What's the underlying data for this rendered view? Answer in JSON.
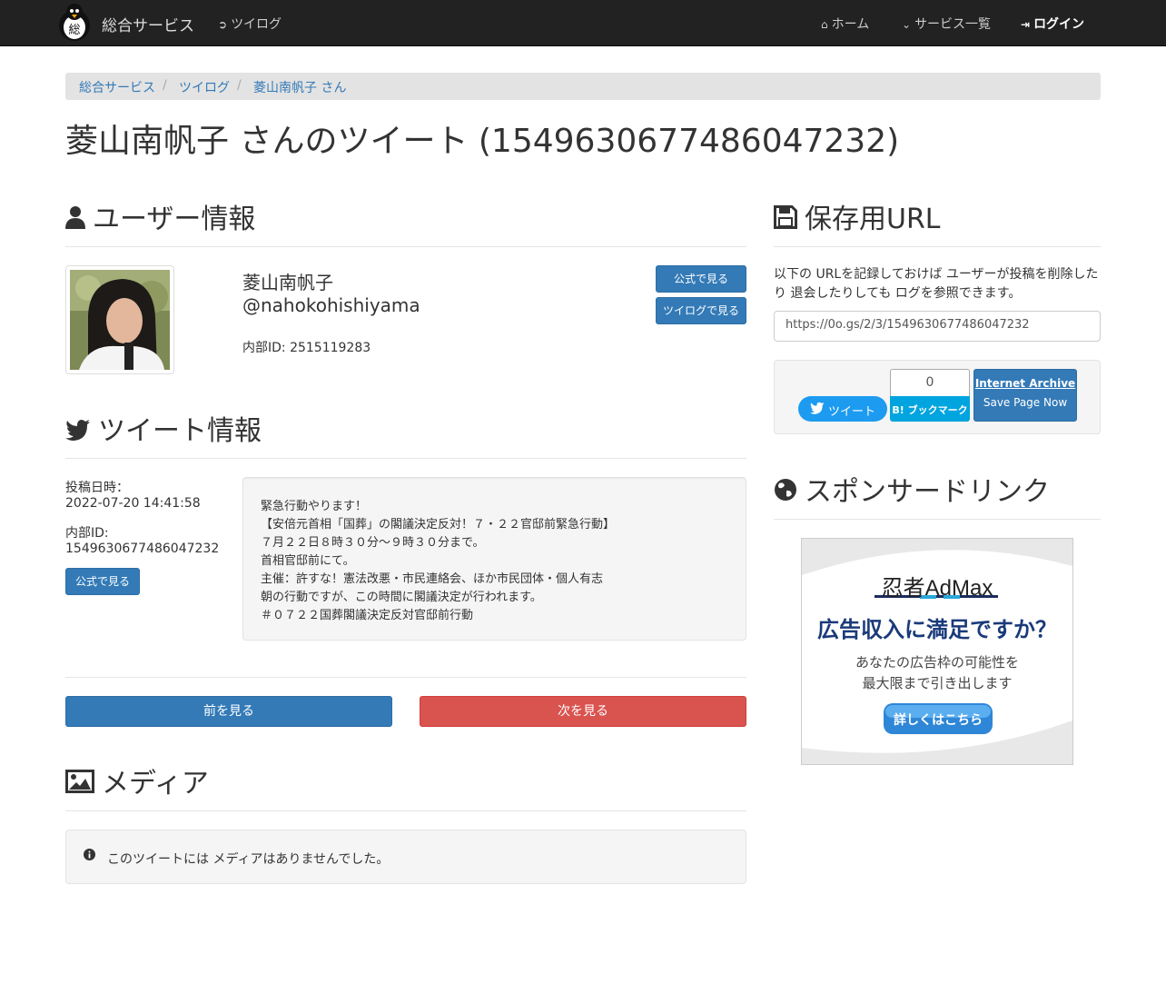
{
  "nav": {
    "brand": "総合サービス",
    "logo_char": "総",
    "left_link": "ツイログ",
    "home": "ホーム",
    "services": "サービス一覧",
    "login": "ログイン"
  },
  "breadcrumb": [
    "総合サービス",
    "ツイログ",
    "菱山南帆子 さん"
  ],
  "page_title": "菱山南帆子 さんのツイート (1549630677486047232)",
  "user_section": {
    "heading": "ユーザー情報",
    "name": "菱山南帆子",
    "handle": "@nahokohishiyama",
    "internal_id": "内部ID: 2515119283",
    "btn_official": "公式で見る",
    "btn_twilog": "ツイログで見る"
  },
  "tweet_section": {
    "heading": "ツイート情報",
    "posted_label": "投稿日時：",
    "posted_value": "2022-07-20 14:41:58",
    "id_label": "内部ID:",
    "id_value": "1549630677486047232",
    "btn_official": "公式で見る",
    "lines": [
      "緊急行動やります！",
      "【安倍元首相「国葬」の閣議決定反対！７・２２官邸前緊急行動】",
      "７月２２日８時３０分～９時３０分まで。",
      "首相官邸前にて。",
      "主催：許すな！憲法改悪・市民連絡会、ほか市民団体・個人有志",
      "朝の行動ですが、この時間に閣議決定が行われます。",
      "＃０７２２国葬閣議決定反対官邸前行動"
    ]
  },
  "pager": {
    "prev": "前を見る",
    "next": "次を見る"
  },
  "media_section": {
    "heading": "メディア",
    "message": "このツイートには メディアはありませんでした。"
  },
  "save_section": {
    "heading": "保存用URL",
    "description": "以下の URLを記録しておけば ユーザーが投稿を削除したり 退会したりしても ログを参照できます。",
    "url": "https://0o.gs/2/3/1549630677486047232",
    "tweet_btn": "ツイート",
    "hatena_count": "0",
    "hatena_label": "B! ブックマーク",
    "ia_title": "Internet Archive",
    "ia_sub": "Save Page Now"
  },
  "sponsor_section": {
    "heading": "スポンサードリンク",
    "ad_brand": "忍者AdMax",
    "ad_headline": "広告収入に満足ですか？",
    "ad_body_1": "あなたの広告枠の可能性を",
    "ad_body_2": "最大限まで引き出します",
    "ad_button": "詳しくはこちら"
  }
}
